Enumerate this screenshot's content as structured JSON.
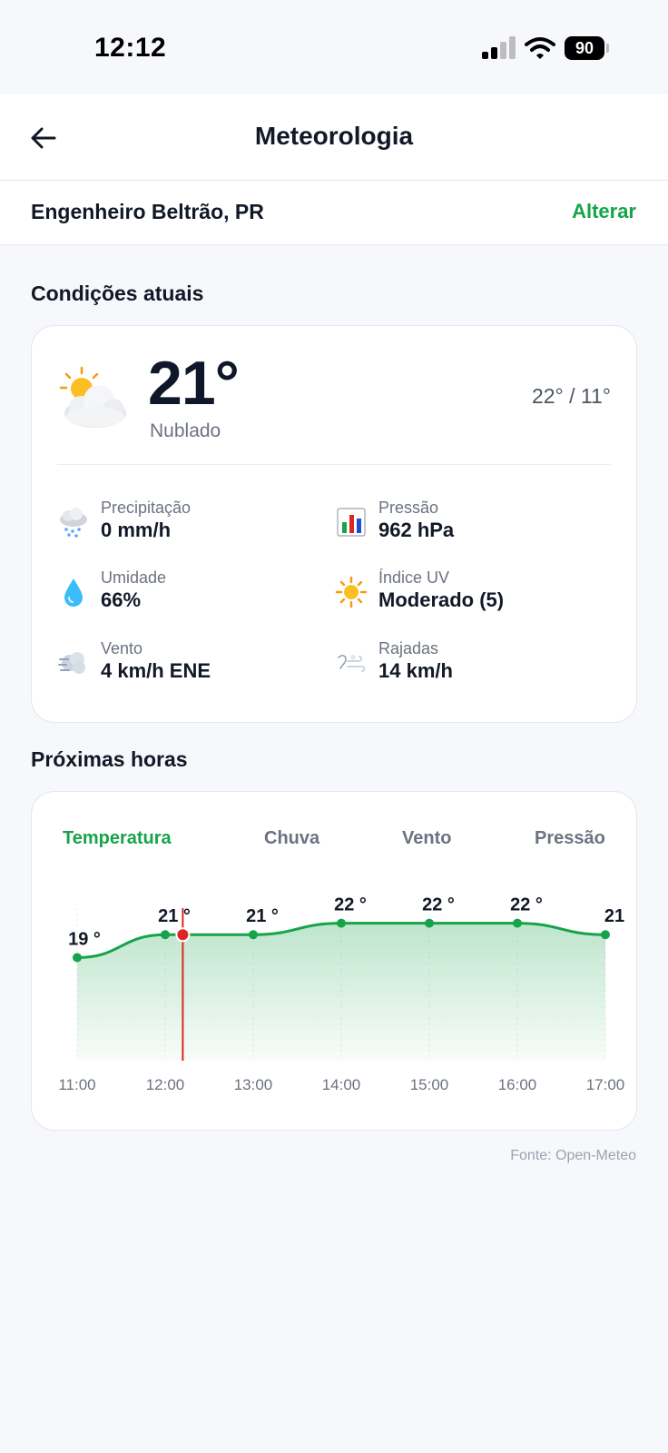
{
  "status_bar": {
    "time": "12:12",
    "battery": "90"
  },
  "header": {
    "title": "Meteorologia",
    "back_icon": "arrow-left-icon"
  },
  "location": {
    "name": "Engenheiro Beltrão, PR",
    "change_label": "Alterar"
  },
  "current_section_title": "Condições atuais",
  "current": {
    "icon": "partly-cloudy-icon",
    "temperature": "21°",
    "description": "Nublado",
    "range": "22° / 11°",
    "metrics": {
      "precipitation": {
        "label": "Precipitação",
        "value": "0 mm/h",
        "icon": "snow-cloud-icon"
      },
      "pressure": {
        "label": "Pressão",
        "value": "962 hPa",
        "icon": "bar-chart-icon"
      },
      "humidity": {
        "label": "Umidade",
        "value": "66%",
        "icon": "droplet-icon"
      },
      "uv": {
        "label": "Índice UV",
        "value": "Moderado (5)",
        "icon": "sun-icon"
      },
      "wind": {
        "label": "Vento",
        "value": "4 km/h ENE",
        "icon": "wind-icon"
      },
      "gusts": {
        "label": "Rajadas",
        "value": "14 km/h",
        "icon": "gust-icon"
      }
    }
  },
  "forecast_section_title": "Próximas horas",
  "forecast": {
    "tabs": [
      "Temperatura",
      "Chuva",
      "Vento",
      "Pressão"
    ],
    "active_tab": "Temperatura"
  },
  "chart_data": {
    "type": "area",
    "title": "",
    "xlabel": "",
    "ylabel": "",
    "x": [
      "11:00",
      "12:00",
      "13:00",
      "14:00",
      "15:00",
      "16:00",
      "17:00"
    ],
    "series": [
      {
        "values": [
          19,
          21,
          21,
          22,
          22,
          22,
          21
        ]
      }
    ],
    "data_labels": [
      "19 °",
      "21 °",
      "21 °",
      "22 °",
      "22 °",
      "22 °",
      "21"
    ],
    "current_time_marker": "12:12",
    "ylim": [
      10,
      23
    ],
    "grid": true,
    "colors": {
      "line": "#16a34a",
      "marker": "#dc2626"
    }
  },
  "source_note": "Fonte: Open-Meteo",
  "colors": {
    "accent": "#16a34a",
    "text": "#111827",
    "muted": "#6b7280",
    "background": "#f7f8fb"
  }
}
